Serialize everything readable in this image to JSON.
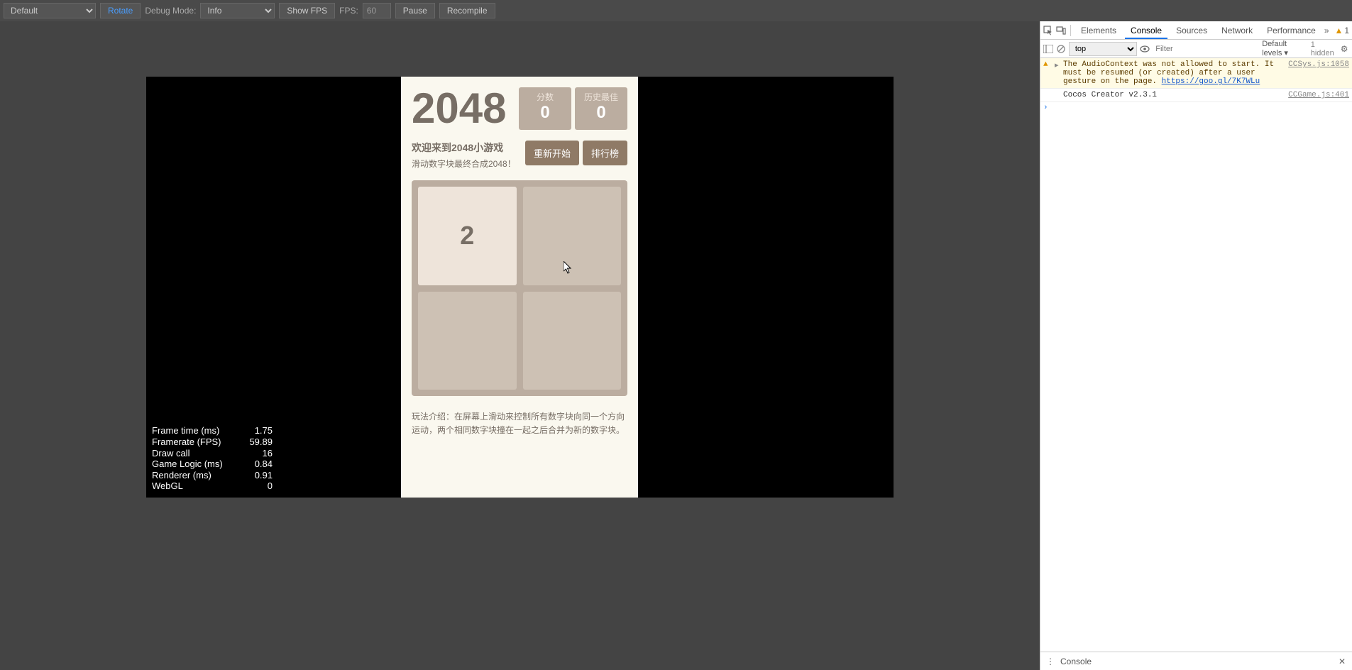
{
  "toolbar": {
    "preset": "Default",
    "rotate": "Rotate",
    "debug_mode_label": "Debug Mode:",
    "debug_mode_value": "Info",
    "show_fps": "Show FPS",
    "fps_label": "FPS:",
    "fps_value": "60",
    "pause": "Pause",
    "recompile": "Recompile"
  },
  "game": {
    "title": "2048",
    "score_label": "分数",
    "score_value": "0",
    "best_label": "历史最佳",
    "best_value": "0",
    "welcome": "欢迎来到2048小游戏",
    "instruction": "滑动数字块最终合成2048！",
    "restart": "重新开始",
    "leaderboard": "排行榜",
    "tile_value": "2",
    "help": "玩法介绍：在屏幕上滑动来控制所有数字块向同一个方向运动，两个相同数字块撞在一起之后合并为新的数字块。"
  },
  "stats": {
    "rows": [
      {
        "label": "Frame time (ms)",
        "value": "1.75"
      },
      {
        "label": "Framerate (FPS)",
        "value": "59.89"
      },
      {
        "label": "Draw call",
        "value": "16"
      },
      {
        "label": "Game Logic (ms)",
        "value": "0.84"
      },
      {
        "label": "Renderer (ms)",
        "value": "0.91"
      },
      {
        "label": "WebGL",
        "value": "0"
      }
    ]
  },
  "devtools": {
    "tabs": {
      "elements": "Elements",
      "console": "Console",
      "sources": "Sources",
      "network": "Network",
      "performance": "Performance"
    },
    "warn_count": "1",
    "filter_context": "top",
    "filter_placeholder": "Filter",
    "levels": "Default levels ▾",
    "hidden": "1 hidden",
    "msg_warn": "The AudioContext was not allowed to start. It must be resumed (or created) after a user gesture on the page. ",
    "msg_warn_link": "https://goo.gl/7K7WLu",
    "msg_warn_src": "CCSys.js:1058",
    "msg_info": "Cocos Creator v2.3.1",
    "msg_info_src": "CCGame.js:401",
    "drawer_label": "Console"
  }
}
